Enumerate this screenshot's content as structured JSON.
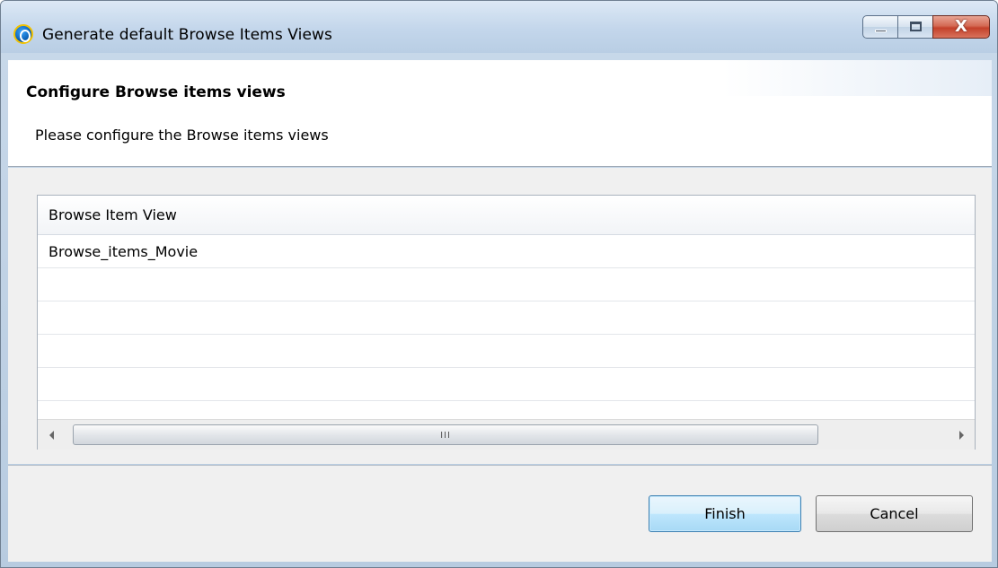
{
  "window": {
    "title": "Generate default Browse Items Views",
    "controls": {
      "minimize": "minimize",
      "maximize": "maximize",
      "close_glyph": "X"
    }
  },
  "header": {
    "title": "Configure Browse items views",
    "description": "Please configure the Browse items views"
  },
  "table": {
    "column_header": "Browse Item View",
    "rows": [
      {
        "label": "Browse_items_Movie"
      },
      {
        "label": ""
      },
      {
        "label": ""
      },
      {
        "label": ""
      },
      {
        "label": ""
      }
    ],
    "scrollbar_grip": "III"
  },
  "buttons": {
    "finish_label": "Finish",
    "cancel_label": "Cancel"
  },
  "colors": {
    "accent_button": "#bee6fd",
    "close_button": "#c4412a",
    "titlebar": "#c3d6eb"
  }
}
